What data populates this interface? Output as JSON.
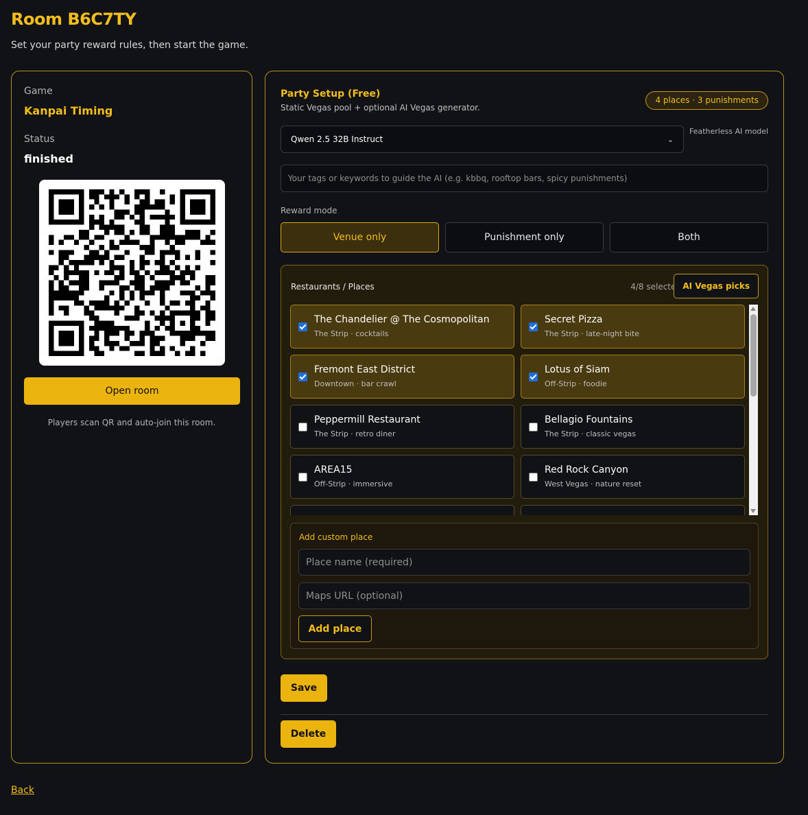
{
  "header": {
    "title": "Room B6C7TY",
    "subtitle": "Set your party reward rules, then start the game."
  },
  "info": {
    "game_label": "Game",
    "game_value": "Kanpai Timing",
    "status_label": "Status",
    "status_value": "finished",
    "open_room_label": "Open room",
    "hint": "Players scan QR and auto-join this room."
  },
  "setup": {
    "title": "Party Setup (Free)",
    "subtitle": "Static Vegas pool + optional AI Vegas generator.",
    "badge": "4 places · 3 punishments",
    "model_selected": "Qwen 2.5 32B Instruct",
    "model_label": "Featherless AI model",
    "tags_placeholder": "Your tags or keywords to guide the AI (e.g. kbbq, rooftop bars, spicy punishments)",
    "reward_mode_label": "Reward mode",
    "reward_modes": [
      "Venue only",
      "Punishment only",
      "Both"
    ],
    "reward_mode_active": "Venue only"
  },
  "places": {
    "title": "Restaurants / Places",
    "selected_count": "4/8 selected",
    "ai_picks_label": "AI Vegas picks",
    "items": [
      {
        "name": "The Chandelier @ The Cosmopolitan",
        "meta": "The Strip · cocktails",
        "checked": true
      },
      {
        "name": "Secret Pizza",
        "meta": "The Strip · late-night bite",
        "checked": true
      },
      {
        "name": "Fremont East District",
        "meta": "Downtown · bar crawl",
        "checked": true
      },
      {
        "name": "Lotus of Siam",
        "meta": "Off-Strip · foodie",
        "checked": true
      },
      {
        "name": "Peppermill Restaurant",
        "meta": "The Strip · retro diner",
        "checked": false
      },
      {
        "name": "Bellagio Fountains",
        "meta": "The Strip · classic vegas",
        "checked": false
      },
      {
        "name": "AREA15",
        "meta": "Off-Strip · immersive",
        "checked": false
      },
      {
        "name": "Red Rock Canyon",
        "meta": "West Vegas · nature reset",
        "checked": false
      }
    ]
  },
  "custom": {
    "title": "Add custom place",
    "name_placeholder": "Place name (required)",
    "url_placeholder": "Maps URL (optional)",
    "add_label": "Add place"
  },
  "actions": {
    "save_label": "Save",
    "delete_label": "Delete",
    "back_label": "Back"
  },
  "colors": {
    "accent": "#f2bd1d",
    "button": "#ebb30d",
    "background": "#111215",
    "checkbox_checked": "#1e6fd9"
  }
}
